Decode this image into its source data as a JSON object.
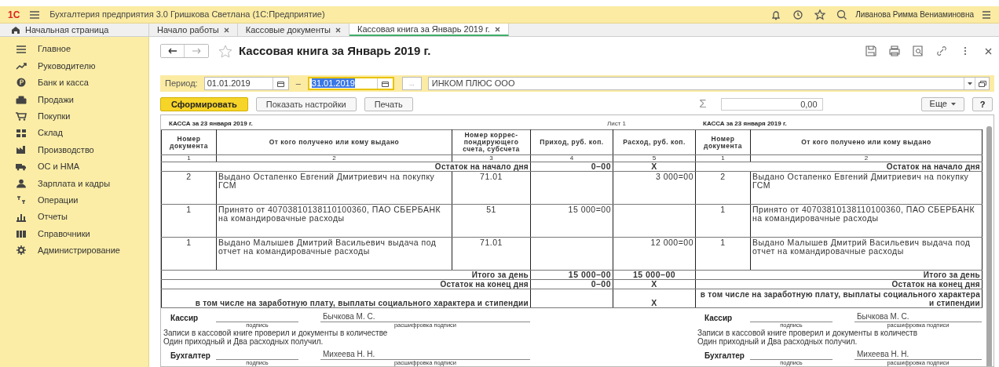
{
  "app": {
    "logo": "1С",
    "title": "Бухгалтерия предприятия 3.0 Гришкова Светлана  (1С:Предприятие)",
    "user": "Ливанова Римма Вениаминовна"
  },
  "tabs": [
    {
      "label": "Начальная страница",
      "kind": "home",
      "selected": false
    },
    {
      "label": "Начало работы",
      "kind": "doc",
      "selected": false
    },
    {
      "label": "Кассовые документы",
      "kind": "doc",
      "selected": false
    },
    {
      "label": "Кассовая книга за Январь 2019 г.",
      "kind": "doc",
      "selected": true
    }
  ],
  "sidebar": {
    "items": [
      {
        "label": "Главное"
      },
      {
        "label": "Руководителю"
      },
      {
        "label": "Банк и касса"
      },
      {
        "label": "Продажи"
      },
      {
        "label": "Покупки"
      },
      {
        "label": "Склад"
      },
      {
        "label": "Производство"
      },
      {
        "label": "ОС и НМА"
      },
      {
        "label": "Зарплата и кадры"
      },
      {
        "label": "Операции"
      },
      {
        "label": "Отчеты"
      },
      {
        "label": "Справочники"
      },
      {
        "label": "Администрирование"
      }
    ]
  },
  "form": {
    "title": "Кассовая книга за Январь 2019 г.",
    "period_label": "Период:",
    "date_from": "01.01.2019",
    "separator": "–",
    "date_to": "31.01.2019",
    "date_to_selected": true,
    "more": "...",
    "organization": "ИНКОМ ПЛЮС ООО",
    "buttons": [
      {
        "label": "Сформировать",
        "kind": "primary"
      },
      {
        "label": "Показать настройки",
        "kind": "default"
      },
      {
        "label": "Печать",
        "kind": "default"
      }
    ],
    "sum_symbol": "Σ",
    "sum_value": "0,00",
    "more_button": "Еще",
    "help_button": "?"
  },
  "report": {
    "sheet_label": "Лист 1",
    "left_page": {
      "heading": "КАССА за 23 января 2019 г.",
      "columns": [
        "Номер документа",
        "От кого получено или кому выдано",
        "Номер коррес-пондирующего счета, субсчета",
        "Приход, руб. коп.",
        "Расход, руб. коп."
      ],
      "column_numbers": [
        "1",
        "2",
        "3",
        "4",
        "5"
      ],
      "opening": {
        "label": "Остаток на начало дня",
        "income": "0–00",
        "expense": "X"
      },
      "rows": [
        {
          "doc": "2",
          "who": "Выдано Остапенко Евгений Дмитриевич на покупку ГСМ",
          "account": "71.01",
          "expense": "3 000=00"
        },
        {
          "doc": "1",
          "who": "Принято от 40703810138110100360, ПАО СБЕРБАНК на командировачные расходы",
          "account": "51",
          "income": "15 000=00"
        },
        {
          "doc": "1",
          "who": "Выдано Малышев Дмитрий Васильевич выдача под отчет на командировачные расходы",
          "account": "71.01",
          "expense": "12 000=00"
        }
      ],
      "totals": [
        {
          "label": "Итого за день",
          "income": "15 000–00",
          "expense": "15 000–00"
        },
        {
          "label": "Остаток на конец  дня",
          "income": "0–00",
          "expense": "X"
        },
        {
          "label": "в том числе на заработную плату, выплаты социального характера и стипендии",
          "expense": "X"
        }
      ],
      "footer": {
        "signatures": [
          {
            "label": "Кассир",
            "name": "Бычкова М. С.",
            "sign_hint": "подпись",
            "decode_hint": "расшифровка подписи"
          },
          {
            "label": "Бухгалтер",
            "name": "Михеева Н. Н.",
            "sign_hint": "подпись",
            "decode_hint": "расшифровка подписи"
          }
        ],
        "note": [
          "Записи в кассовой книге проверил и документы в количестве",
          "Один приходный и Два расходных получил."
        ]
      }
    },
    "right_page": {
      "heading": "КАССА за 23 января 2019 г.",
      "columns": [
        "Номер документа",
        "От кого получено или кому выдано"
      ],
      "column_numbers": [
        "1",
        "2"
      ],
      "opening": {
        "label": "Остаток на начало дня"
      },
      "rows": [
        {
          "doc": "2",
          "who": "Выдано Остапенко Евгений Дмитриевич на покупку ГСМ"
        },
        {
          "doc": "1",
          "who": "Принято от 40703810138110100360, ПАО СБЕРБАНК на командировачные расходы"
        },
        {
          "doc": "1",
          "who": "Выдано Малышев Дмитрий Васильевич выдача под отчет на командировачные расходы"
        }
      ],
      "totals": [
        {
          "label": "Итого за день"
        },
        {
          "label": "Остаток на конец  дня"
        },
        {
          "label": "в том числе на заработную плату, выплаты социального характера и стипендии"
        }
      ],
      "footer": {
        "signatures": [
          {
            "label": "Кассир",
            "name": "Бычкова М. С.",
            "sign_hint": "подпись",
            "decode_hint": "расшифровка подписи"
          },
          {
            "label": "Бухгалтер",
            "name": "Михеева Н. Н.",
            "sign_hint": "подпись",
            "decode_hint": "расшифровка подписи"
          }
        ],
        "note": [
          "Записи в кассовой книге проверил и документы в количеств",
          "Один приходный и Два расходных получил."
        ]
      }
    }
  }
}
